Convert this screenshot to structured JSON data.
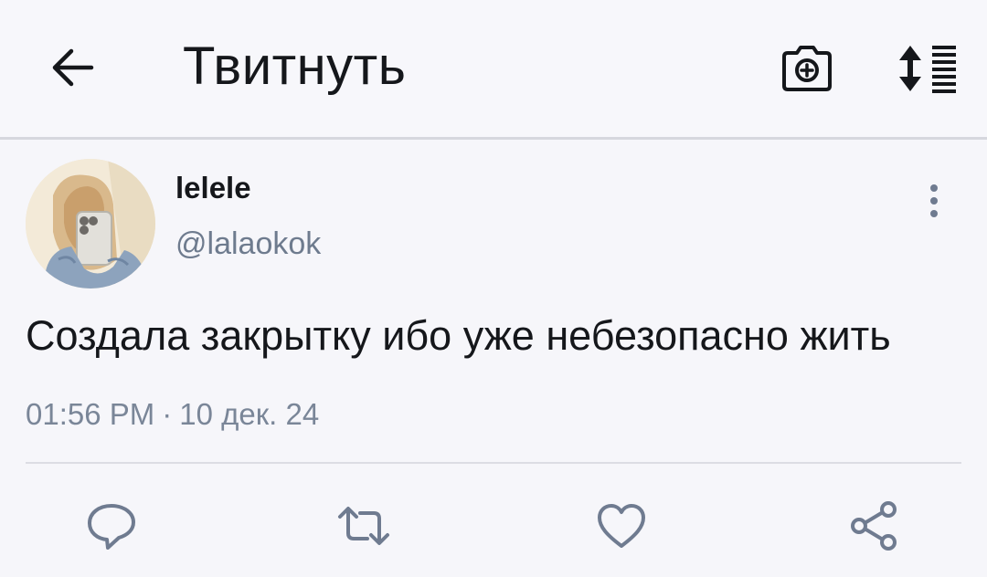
{
  "header": {
    "title": "Твитнуть",
    "icons": {
      "back": "arrow-left-icon",
      "camera": "camera-icon",
      "sort": "sort-list-icon"
    }
  },
  "tweet": {
    "author": {
      "display_name": "lelele",
      "handle": "@lalaokok"
    },
    "text": "Создала закрытку ибо уже небезопасно жить",
    "time": "01:56 PM",
    "separator": "·",
    "date": "10 дек. 24"
  },
  "actions": [
    "reply-icon",
    "retweet-icon",
    "heart-icon",
    "share-icon"
  ],
  "colors": {
    "background": "#f6f6fa",
    "text": "#15171b",
    "secondary_text": "#6e7b8e",
    "icon": "#6f7b90"
  }
}
